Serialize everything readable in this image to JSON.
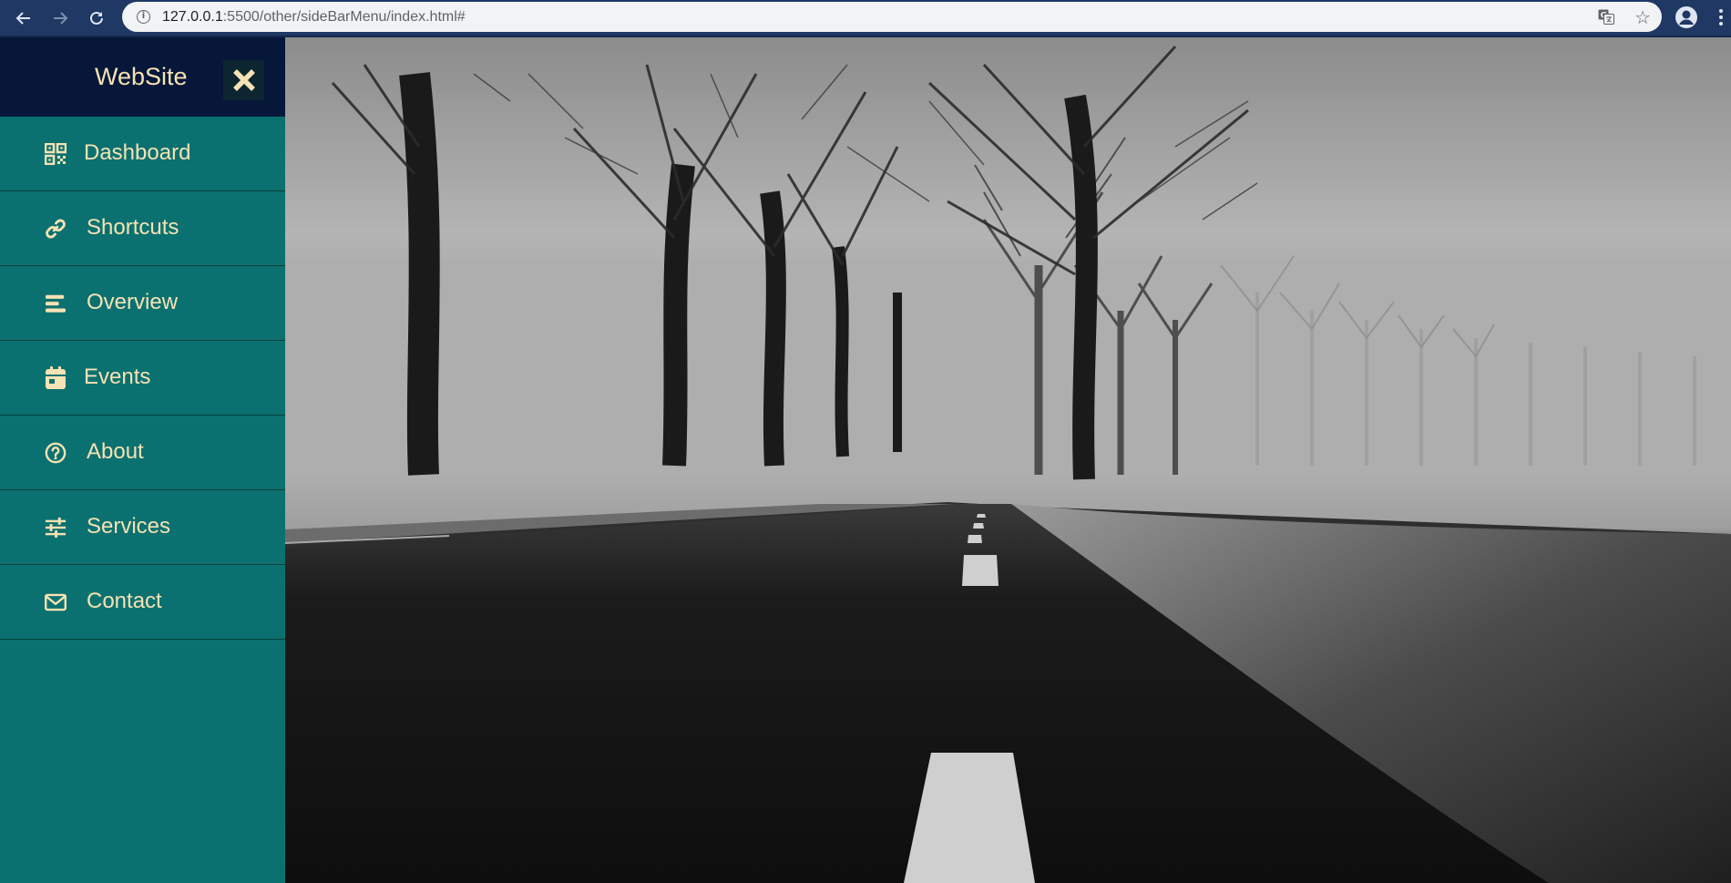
{
  "browser": {
    "url_host": "127.0.0.1",
    "url_rest": ":5500/other/sideBarMenu/index.html#",
    "back_icon": "arrow-left-icon",
    "forward_icon": "arrow-right-icon",
    "reload_icon": "reload-icon"
  },
  "sidebar": {
    "brand": "WebSite",
    "close_icon": "close-icon",
    "items": [
      {
        "label": "Dashboard",
        "icon": "qr-grid-icon"
      },
      {
        "label": "Shortcuts",
        "icon": "link-icon"
      },
      {
        "label": "Overview",
        "icon": "bars-icon"
      },
      {
        "label": "Events",
        "icon": "calendar-icon"
      },
      {
        "label": "About",
        "icon": "question-circle-icon"
      },
      {
        "label": "Services",
        "icon": "sliders-icon"
      },
      {
        "label": "Contact",
        "icon": "envelope-icon"
      }
    ]
  },
  "colors": {
    "sidebar_bg": "#0b7170",
    "header_bg": "#06173a",
    "text_accent": "#f6e2b3",
    "chrome_bg": "#1f3864"
  }
}
